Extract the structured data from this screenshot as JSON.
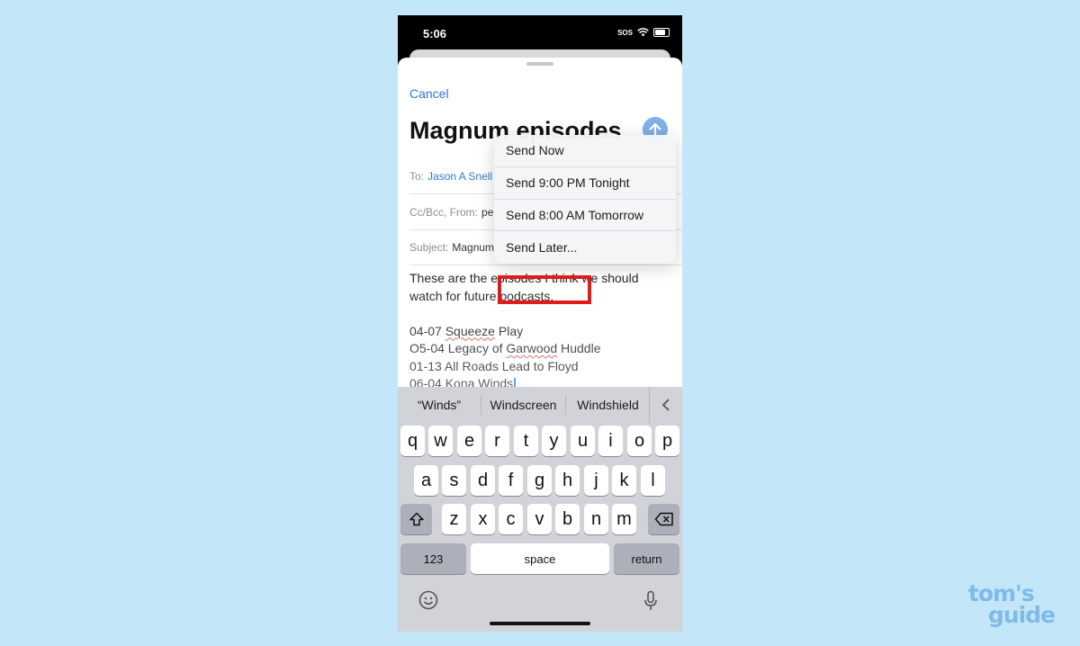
{
  "status_bar": {
    "time": "5:06",
    "sos": "SOS"
  },
  "compose": {
    "cancel": "Cancel",
    "title": "Magnum episodes",
    "to_label": "To:",
    "to_value": "Jason A Snell",
    "cc_label": "Cc/Bcc, From:",
    "cc_value": "pe",
    "subject_label": "Subject:",
    "subject_value": "Magnum",
    "body_lines": [
      "These are the episodes I think we should",
      "watch for future podcasts.",
      "",
      "04-07 Squeeze Play",
      "O5-04 Legacy of Garwood Huddle",
      "01-13 All Roads Lead to Floyd",
      "06-04 Kona Winds"
    ]
  },
  "send_menu": {
    "items": [
      "Send Now",
      "Send 9:00 PM Tonight",
      "Send 8:00 AM Tomorrow",
      "Send Later..."
    ]
  },
  "keyboard": {
    "suggestions": [
      "“Winds”",
      "Windscreen",
      "Windshield"
    ],
    "row1": [
      "q",
      "w",
      "e",
      "r",
      "t",
      "y",
      "u",
      "i",
      "o",
      "p"
    ],
    "row2": [
      "a",
      "s",
      "d",
      "f",
      "g",
      "h",
      "j",
      "k",
      "l"
    ],
    "row3": [
      "z",
      "x",
      "c",
      "v",
      "b",
      "n",
      "m"
    ],
    "numbers_label": "123",
    "space_label": "space",
    "return_label": "return"
  },
  "watermark": {
    "line1": "tom's",
    "line2": "guide"
  },
  "colors": {
    "accent": "#2a7ad6",
    "highlight": "#e21a1a",
    "background": "#c3e6f8"
  }
}
